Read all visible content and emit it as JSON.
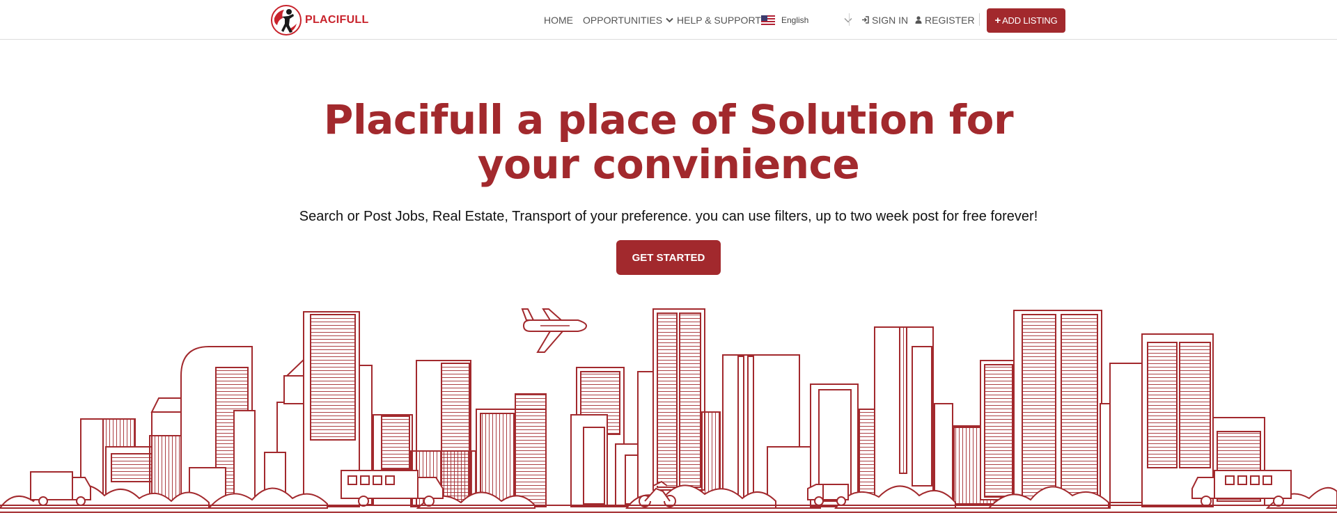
{
  "brand": {
    "name": "PLACIFULL",
    "accent": "#a2292d",
    "logo_red": "#c8232c"
  },
  "nav": {
    "home": "HOME",
    "opportunities": "OPPORTUNITIES",
    "help": "HELP & SUPPORT",
    "language": {
      "selected": "English",
      "flag_icon": "us-flag-icon"
    },
    "sign_in": "SIGN IN",
    "register": "REGISTER",
    "add_listing": "ADD LISTING"
  },
  "hero": {
    "title_line1": "Placifull a place of Solution for",
    "title_line2": "your convinience",
    "subtitle": "Search or Post Jobs, Real Estate, Transport of your preference. you can use filters, up to two week post for free forever!",
    "cta": "GET STARTED"
  },
  "illustration": {
    "name": "city-skyline-illustration",
    "line_color": "#a2292d"
  }
}
